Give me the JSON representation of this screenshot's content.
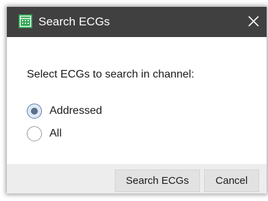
{
  "dialog": {
    "title": "Search ECGs",
    "prompt": "Select ECGs to search in channel:",
    "options": [
      {
        "label": "Addressed",
        "checked": true
      },
      {
        "label": "All",
        "checked": false
      }
    ],
    "buttons": {
      "search_label": "Search ECGs",
      "cancel_label": "Cancel"
    }
  },
  "colors": {
    "titlebar": "#404040",
    "app_icon": "#2aa44f",
    "footer": "#ededed"
  },
  "icons": {
    "app": "grid-calendar-icon",
    "close": "close-icon"
  }
}
